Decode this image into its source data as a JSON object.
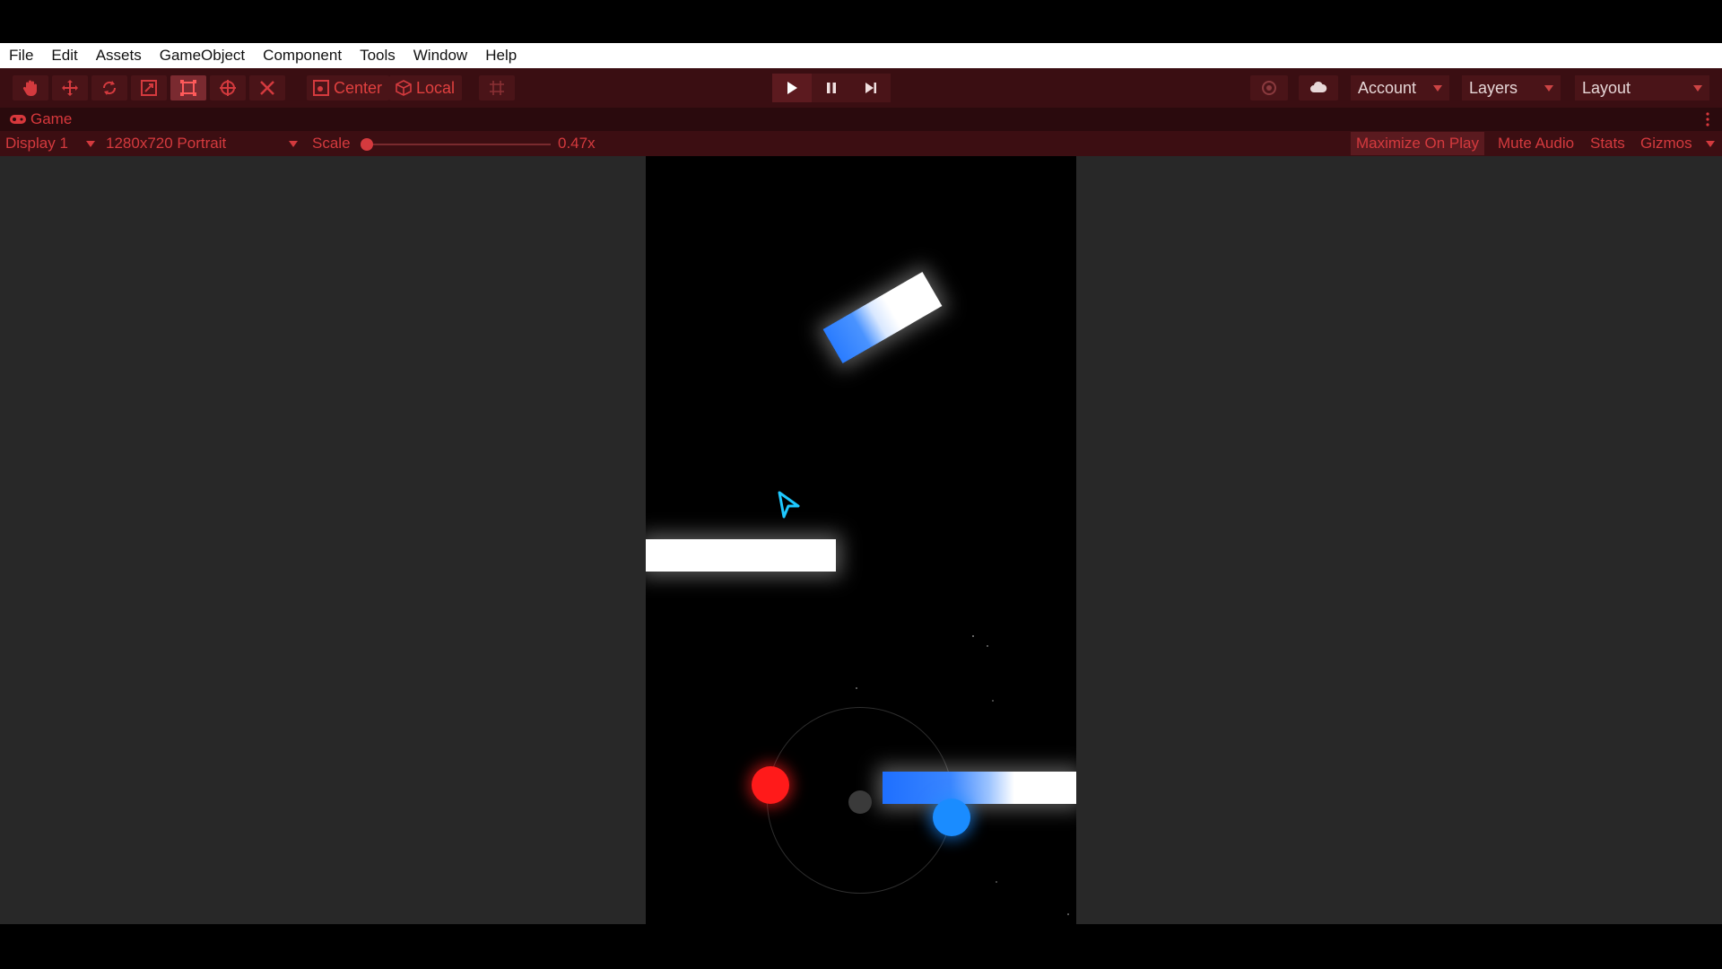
{
  "menu": [
    "File",
    "Edit",
    "Assets",
    "GameObject",
    "Component",
    "Tools",
    "Window",
    "Help"
  ],
  "toolbar": {
    "tools": [
      "hand-tool",
      "move-tool",
      "rotate-tool",
      "scale-tool",
      "rect-tool",
      "transform-tool",
      "custom-tool"
    ],
    "pivot_label": "Center",
    "space_label": "Local",
    "account_label": "Account",
    "layers_label": "Layers",
    "layout_label": "Layout"
  },
  "game_tab": {
    "label": "Game"
  },
  "game_controls": {
    "display": "Display 1",
    "resolution": "1280x720 Portrait",
    "scale_label": "Scale",
    "scale_value": "0.47x",
    "maximize_label": "Maximize On Play",
    "mute_label": "Mute Audio",
    "stats_label": "Stats",
    "gizmos_label": "Gizmos"
  },
  "colors": {
    "accent": "#d43a3e",
    "toolbar_bg": "#3a0e12",
    "panel_bg": "#282828",
    "player_red": "#ff1a1a",
    "player_blue": "#1a8cff"
  }
}
